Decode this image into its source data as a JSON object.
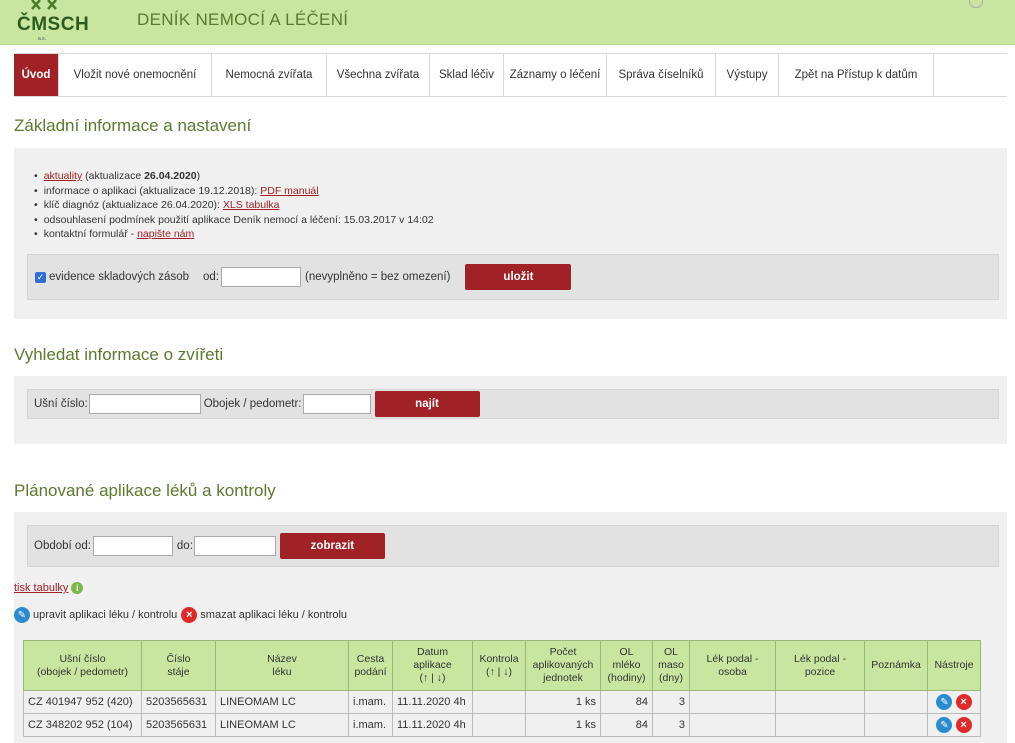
{
  "header": {
    "logo": "ČMSCH",
    "logo_sub": "a.s.",
    "title": "DENÍK NEMOCÍ A LÉČENÍ"
  },
  "nav": [
    "Úvod",
    "Vložit nové onemocnění",
    "Nemocná zvířata",
    "Všechna zvířata",
    "Sklad léčiv",
    "Záznamy o léčení",
    "Správa číselníků",
    "Výstupy",
    "Zpět na Přístup k datům"
  ],
  "basic": {
    "title": "Základní informace a nastavení",
    "b1_link": "aktuality",
    "b1_pre": "(aktualizace ",
    "b1_date": "26.04.2020",
    "b1_post": ")",
    "b2_text": "informace o aplikaci (aktualizace 19.12.2018):",
    "b2_link": "PDF manuál",
    "b3_text": "klíč diagnóz (aktualizace 26.04.2020):",
    "b3_link": "XLS tabulka",
    "b4_text": "odsouhlasení podmínek použití aplikace Deník nemocí a léčení: 15.03.2017 v 14:02",
    "b5_text": "kontaktní formulář -",
    "b5_link": "napište nám",
    "stock_label": "evidence skladových zásob",
    "from_label": "od:",
    "from_value": "",
    "note": "(nevyplněno = bez omezení)",
    "save": "uložit"
  },
  "search": {
    "title": "Vyhledat informace o zvířeti",
    "ear_label": "Ušní číslo:",
    "ear_value": "",
    "collar_label": "Obojek / pedometr:",
    "collar_value": "",
    "find": "najít"
  },
  "planned": {
    "title": "Plánované aplikace léků a kontroly",
    "period_label": "Období od:",
    "period_from": "",
    "to_label": "do:",
    "period_to": "",
    "show": "zobrazit",
    "print": "tisk tabulky",
    "edit_legend": "upravit aplikaci léku / kontrolu",
    "delete_legend": "smazat aplikaci léku / kontrolu",
    "columns": {
      "ear": [
        "Ušní číslo",
        "(obojek / pedometr)"
      ],
      "stable": [
        "Číslo",
        "stáje"
      ],
      "drug": [
        "Název",
        "léku"
      ],
      "route": [
        "Cesta",
        "podání"
      ],
      "date": [
        "Datum",
        "aplikace",
        "(↑ | ↓)"
      ],
      "check": [
        "Kontrola",
        "(↑ | ↓)"
      ],
      "units": [
        "Počet",
        "aplikovaných",
        "jednotek"
      ],
      "milk": [
        "OL",
        "mléko",
        "(hodiny)"
      ],
      "meat": [
        "OL",
        "maso",
        "(dny)"
      ],
      "person": [
        "Lék podal -",
        "osoba"
      ],
      "position": [
        "Lék podal -",
        "pozice"
      ],
      "note": "Poznámka",
      "tools": "Nástroje"
    },
    "rows": [
      {
        "ear": "CZ 401947 952 (420)",
        "stable": "5203565631",
        "drug": "LINEOMAM LC",
        "route": "i.mam.",
        "date": "11.11.2020 4h",
        "check": "",
        "units": "1 ks",
        "milk": "84",
        "meat": "3",
        "person": "",
        "position": "",
        "note": ""
      },
      {
        "ear": "CZ 348202 952 (104)",
        "stable": "5203565631",
        "drug": "LINEOMAM LC",
        "route": "i.mam.",
        "date": "11.11.2020 4h",
        "check": "",
        "units": "1 ks",
        "milk": "84",
        "meat": "3",
        "person": "",
        "position": "",
        "note": ""
      }
    ]
  },
  "icons": {
    "edit": "pencil-icon",
    "delete": "x-icon",
    "info": "info-icon",
    "check": "checkmark-icon"
  },
  "colors": {
    "brand_green": "#c8e6a0",
    "accent_red": "#a02226",
    "title_green": "#5a7a2e"
  }
}
